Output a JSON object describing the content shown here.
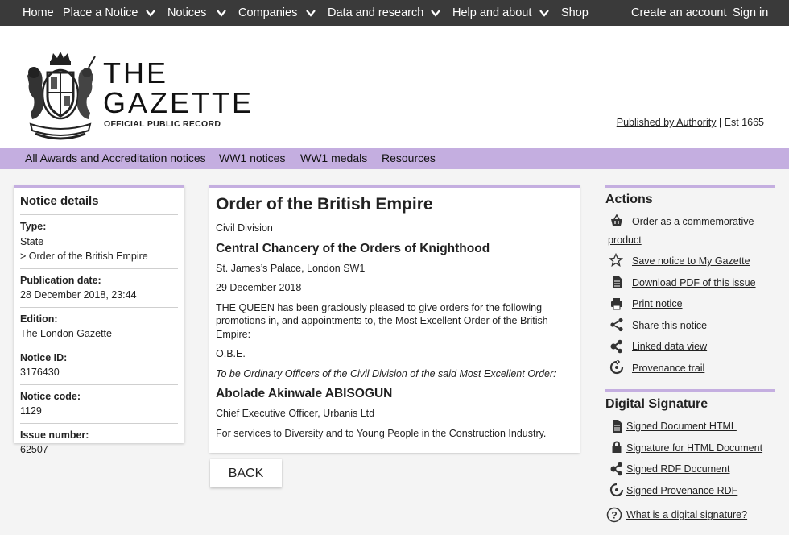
{
  "topnav": {
    "home": "Home",
    "place_notice": "Place a Notice",
    "notices": "Notices",
    "companies": "Companies",
    "data_research": "Data and research",
    "help_about": "Help and about",
    "shop": "Shop",
    "create_account": "Create an account",
    "sign_in": "Sign in"
  },
  "header": {
    "the": "THE",
    "gazette": "GAZETTE",
    "subtitle": "OFFICIAL PUBLIC RECORD",
    "published_link": "Published by Authority",
    "established": " | Est 1665"
  },
  "subnav": {
    "items": [
      "All Awards and Accreditation notices",
      "WW1 notices",
      "WW1 medals",
      "Resources"
    ]
  },
  "details": {
    "title": "Notice details",
    "type_label": "Type:",
    "type_value": "State",
    "type_sub": "> Order of the British Empire",
    "pubdate_label": "Publication date:",
    "pubdate_value": "28 December 2018, 23:44",
    "edition_label": "Edition:",
    "edition_value": "The London Gazette",
    "notice_id_label": "Notice ID:",
    "notice_id_value": "3176430",
    "notice_code_label": "Notice code:",
    "notice_code_value": "1129",
    "issue_label": "Issue number:",
    "issue_value": "62507"
  },
  "notice": {
    "title": "Order of the British Empire",
    "division": "Civil Division",
    "chancery": "Central Chancery of the Orders of Knighthood",
    "address": "St. James’s Palace, London SW1",
    "date": "29 December 2018",
    "body": "THE QUEEN has been graciously pleased to give orders for the following promotions in, and appointments to, the Most Excellent Order of the British Empire:",
    "obe": "O.B.E.",
    "italic": "To be Ordinary Officers of the Civil Division of the said Most Excellent Order:",
    "name": "Abolade Akinwale ABISOGUN",
    "role": "Chief Executive Officer, Urbanis Ltd",
    "citation": "For services to Diversity and to Young People in the Construction Industry."
  },
  "back_label": "BACK",
  "actions": {
    "title": "Actions",
    "order_line1": "Order as a commemorative",
    "order_line2": "product",
    "save": "Save notice to My Gazette",
    "pdf": "Download PDF of this issue",
    "print": "Print notice",
    "share": "Share this notice",
    "linked": "Linked data view",
    "provenance": "Provenance trail"
  },
  "signature": {
    "title": "Digital Signature",
    "signed_html": "Signed Document HTML",
    "sig_html": "Signature for HTML Document",
    "signed_rdf": "Signed RDF Document",
    "signed_prov": "Signed Provenance RDF",
    "what": "What is a digital signature?"
  },
  "colors": {
    "nav_bg": "#3a3a3a",
    "accent_purple": "#c4aee0"
  }
}
